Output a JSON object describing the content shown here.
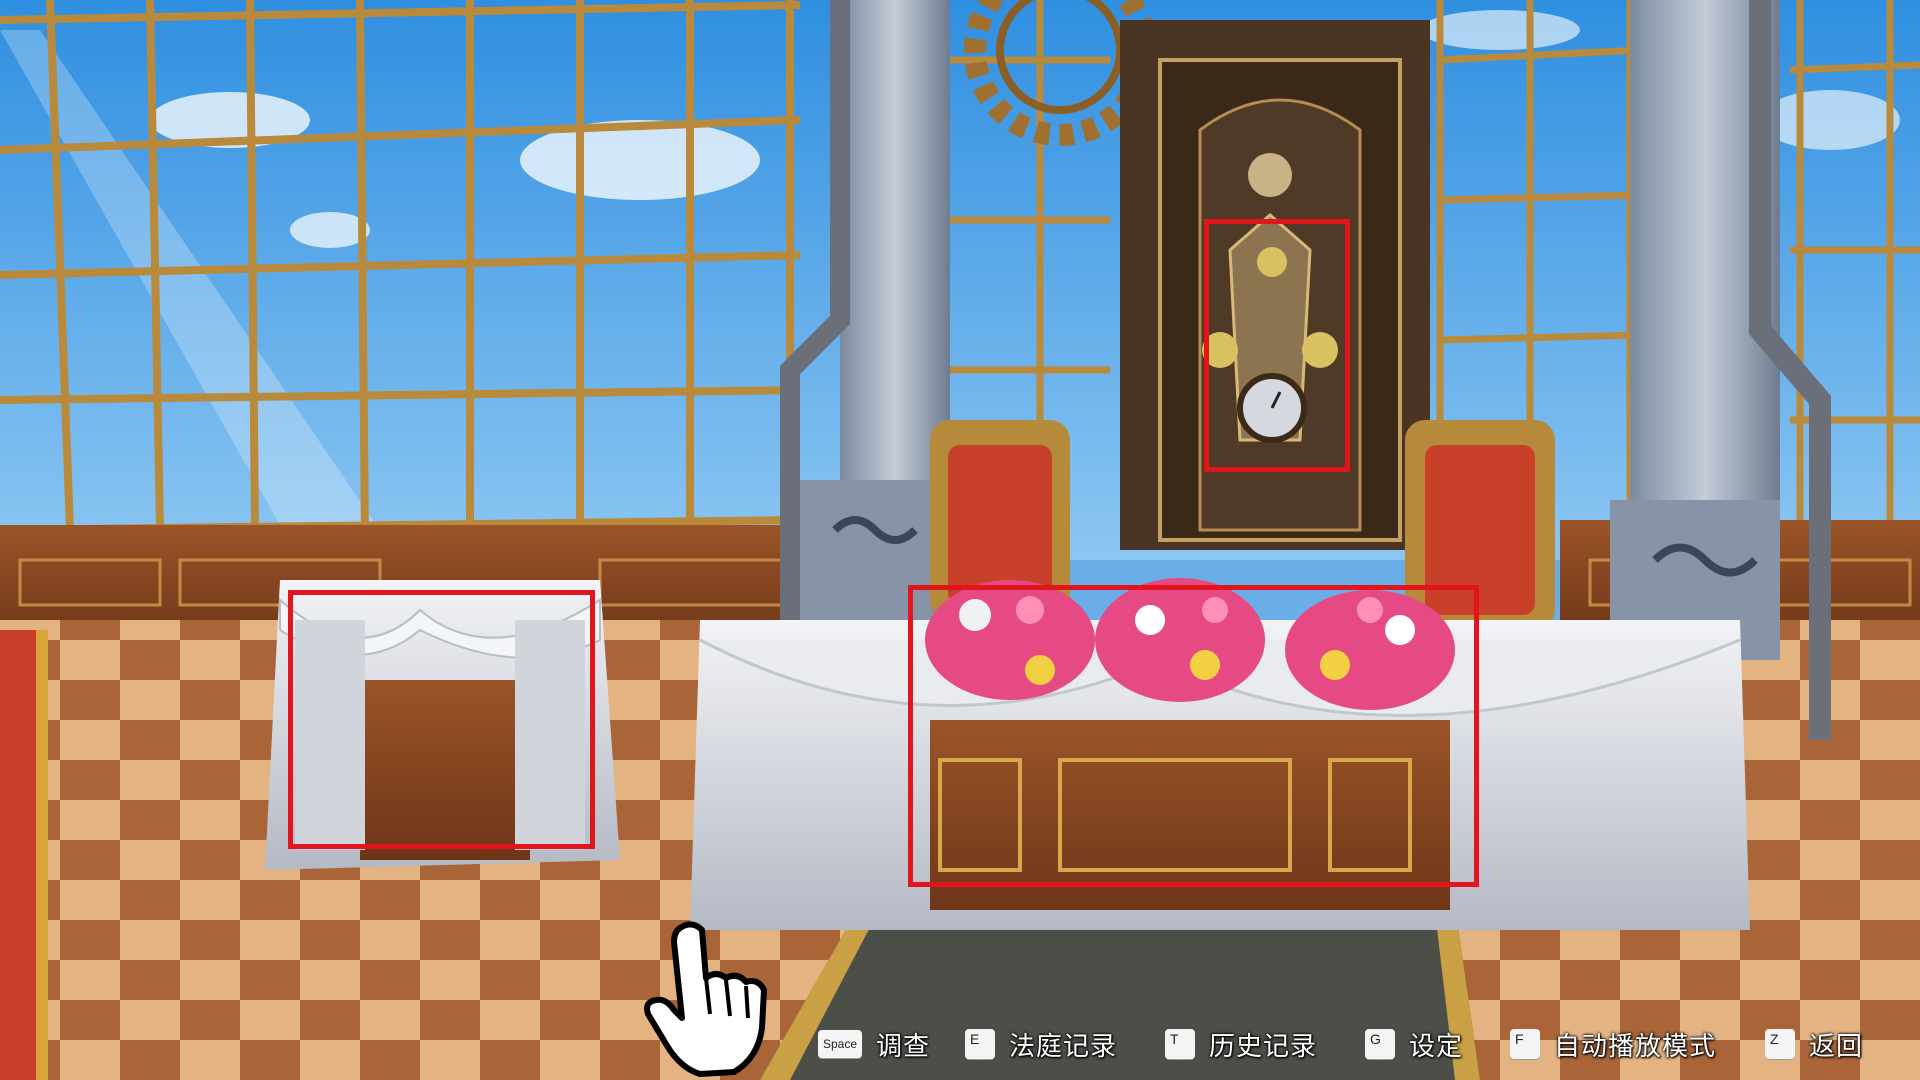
{
  "controls": [
    {
      "key": "Space",
      "label": "调查"
    },
    {
      "key": "E",
      "label": "法庭记录"
    },
    {
      "key": "T",
      "label": "历史记录"
    },
    {
      "key": "G",
      "label": "设定"
    },
    {
      "key": "F",
      "label": "自动播放模式"
    },
    {
      "key": "Z",
      "label": "返回"
    }
  ],
  "colors": {
    "sky": "#5aa8ea",
    "window_frame": "#b98a3c",
    "highlight": "#e2141c",
    "chair_red": "#c8402a",
    "tablecloth": "#dfe2e8",
    "floor_light": "#f0c48e",
    "floor_dark": "#a45f36"
  },
  "icons": [
    "pointing-hand-cursor-icon"
  ]
}
